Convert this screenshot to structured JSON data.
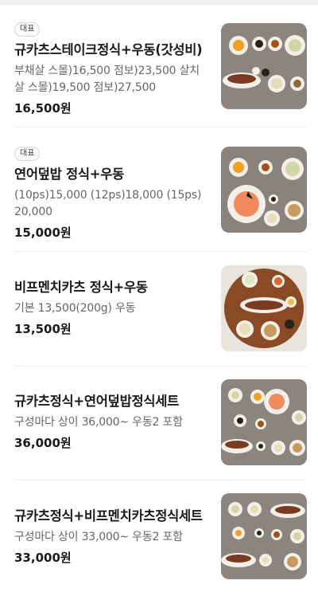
{
  "menu": {
    "items": [
      {
        "badge": "대표",
        "name": "규카츠스테이크정식+우동(갓성비)",
        "description_line1": "부채살 스몰)16,500 점보)23,500 살치",
        "description_line2": "살 스몰)19,500 점보)27,500",
        "price": "16,500원",
        "image": "gyukatsu-steak-set-photo"
      },
      {
        "badge": "대표",
        "name": "연어덮밥 정식+우동",
        "description_line1": "(10ps)15,000 (12ps)18,000 (15ps)",
        "description_line2": "20,000",
        "price": "15,000원",
        "image": "salmon-rice-bowl-set-photo"
      },
      {
        "name": "비프멘치카츠 정식+우동",
        "description_line1": "기본 13,500(200g) 우동",
        "price": "13,500원",
        "image": "beef-menchi-katsu-set-photo"
      },
      {
        "name": "규카츠정식+연어덮밥정식세트",
        "description_line1": "구성마다 상이 36,000~ 우동2 포함",
        "price": "36,000원",
        "image": "gyukatsu-salmon-combo-photo"
      },
      {
        "name": "규카츠정식+비프멘치카츠정식세트",
        "description_line1": "구성마다 상이 33,000~ 우동2 포함",
        "price": "33,000원",
        "image": "gyukatsu-menchi-combo-photo"
      }
    ]
  },
  "colors": {
    "background": "#ffffff",
    "title_text": "#1a1a1a",
    "description_text": "#666666",
    "divider": "#ececec",
    "table_surface": "#8d8580"
  }
}
